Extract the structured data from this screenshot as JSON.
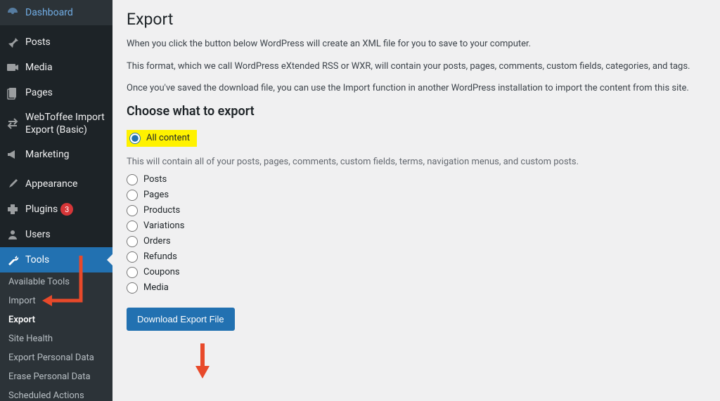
{
  "sidebar": {
    "items": [
      {
        "label": "Dashboard",
        "icon": "dashboard"
      },
      {
        "label": "Posts",
        "icon": "pin"
      },
      {
        "label": "Media",
        "icon": "media"
      },
      {
        "label": "Pages",
        "icon": "pages"
      },
      {
        "label": "WebToffee Import Export (Basic)",
        "icon": "import-export"
      },
      {
        "label": "Marketing",
        "icon": "megaphone"
      },
      {
        "label": "Appearance",
        "icon": "brush"
      },
      {
        "label": "Plugins",
        "icon": "plugin",
        "badge": "3"
      },
      {
        "label": "Users",
        "icon": "users"
      },
      {
        "label": "Tools",
        "icon": "wrench",
        "active": true
      }
    ],
    "submenu": [
      {
        "label": "Available Tools"
      },
      {
        "label": "Import"
      },
      {
        "label": "Export",
        "current": true
      },
      {
        "label": "Site Health"
      },
      {
        "label": "Export Personal Data"
      },
      {
        "label": "Erase Personal Data"
      },
      {
        "label": "Scheduled Actions"
      }
    ]
  },
  "page": {
    "title": "Export",
    "intro": [
      "When you click the button below WordPress will create an XML file for you to save to your computer.",
      "This format, which we call WordPress eXtended RSS or WXR, will contain your posts, pages, comments, custom fields, categories, and tags.",
      "Once you've saved the download file, you can use the Import function in another WordPress installation to import the content from this site."
    ],
    "choose_heading": "Choose what to export",
    "options": [
      {
        "label": "All content",
        "checked": true
      },
      {
        "label": "Posts"
      },
      {
        "label": "Pages"
      },
      {
        "label": "Products"
      },
      {
        "label": "Variations"
      },
      {
        "label": "Orders"
      },
      {
        "label": "Refunds"
      },
      {
        "label": "Coupons"
      },
      {
        "label": "Media"
      }
    ],
    "all_content_desc": "This will contain all of your posts, pages, comments, custom fields, terms, navigation menus, and custom posts.",
    "download_button": "Download Export File"
  }
}
